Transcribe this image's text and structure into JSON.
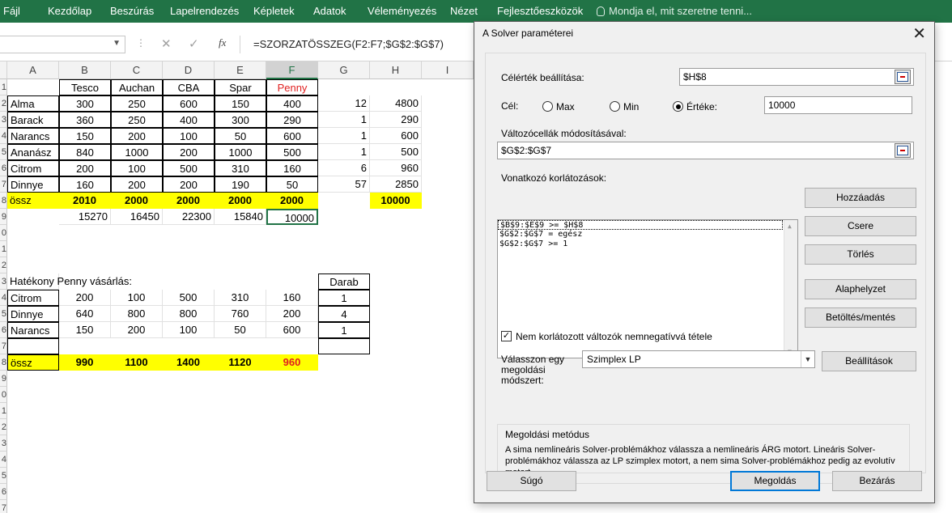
{
  "ribbon": {
    "tabs": [
      "Fájl",
      "Kezdőlap",
      "Beszúrás",
      "Lapelrendezés",
      "Képletek",
      "Adatok",
      "Véleményezés",
      "Nézet",
      "Fejlesztőeszközök"
    ],
    "tell_me": "Mondja el, mit szeretne tenni..."
  },
  "formula_bar": {
    "fx": "fx",
    "formula": "=SZORZATÖSSZEG(F2:F7;$G$2:$G$7)"
  },
  "sheet": {
    "columns": [
      "A",
      "B",
      "C",
      "D",
      "E",
      "F",
      "G",
      "H",
      "I"
    ],
    "row_numbers": [
      "1",
      "2",
      "3",
      "4",
      "5",
      "6",
      "7",
      "8",
      "9",
      "0",
      "1",
      "2",
      "3",
      "4",
      "5",
      "6",
      "7",
      "8",
      "9",
      "0",
      "1",
      "2",
      "3",
      "4",
      "5",
      "6",
      "7",
      "8"
    ],
    "header_row": [
      "",
      "Tesco",
      "Auchan",
      "CBA",
      "Spar",
      "Penny"
    ],
    "fruit_rows": [
      {
        "name": "Alma",
        "values": [
          "300",
          "250",
          "600",
          "150",
          "400"
        ],
        "g": "12",
        "h": "4800"
      },
      {
        "name": "Barack",
        "values": [
          "360",
          "250",
          "400",
          "300",
          "290"
        ],
        "g": "1",
        "h": "290"
      },
      {
        "name": "Narancs",
        "values": [
          "150",
          "200",
          "100",
          "50",
          "600"
        ],
        "g": "1",
        "h": "600"
      },
      {
        "name": "Ananász",
        "values": [
          "840",
          "1000",
          "200",
          "1000",
          "500"
        ],
        "g": "1",
        "h": "500"
      },
      {
        "name": "Citrom",
        "values": [
          "200",
          "100",
          "500",
          "310",
          "160"
        ],
        "g": "6",
        "h": "960"
      },
      {
        "name": "Dinnye",
        "values": [
          "160",
          "200",
          "200",
          "190",
          "50"
        ],
        "g": "57",
        "h": "2850"
      }
    ],
    "ossz_row": {
      "label": "össz",
      "values": [
        "2010",
        "2000",
        "2000",
        "2000",
        "2000"
      ],
      "h": "10000"
    },
    "product_row": [
      "15270",
      "16450",
      "22300",
      "15840",
      "10000"
    ],
    "hatekony_title": "Hatékony Penny vásárlás:",
    "darab_label": "Darab",
    "penny_rows": [
      {
        "name": "Citrom",
        "values": [
          "200",
          "100",
          "500",
          "310",
          "160"
        ],
        "darab": "1"
      },
      {
        "name": "Dinnye",
        "values": [
          "640",
          "800",
          "800",
          "760",
          "200"
        ],
        "darab": "4"
      },
      {
        "name": "Narancs",
        "values": [
          "150",
          "200",
          "100",
          "50",
          "600"
        ],
        "darab": "1"
      }
    ],
    "penny_ossz": {
      "label": "össz",
      "values": [
        "990",
        "1100",
        "1400",
        "1120",
        "960"
      ]
    }
  },
  "dialog": {
    "title": "A Solver paraméterei",
    "objective_label": "Célérték beállítása:",
    "objective_value": "$H$8",
    "to_label": "Cél:",
    "radio_max": "Max",
    "radio_min": "Min",
    "radio_value": "Értéke:",
    "target_value": "10000",
    "changing_label": "Változócellák módosításával:",
    "changing_value": "$G$2:$G$7",
    "constraints_label": "Vonatkozó korlátozások:",
    "constraints": [
      "$B$9:$E$9 >= $H$8",
      "$G$2:$G$7 = egész",
      "$G$2:$G$7 >= 1"
    ],
    "btn_add": "Hozzáadás",
    "btn_change": "Csere",
    "btn_delete": "Törlés",
    "btn_reset": "Alaphelyzet",
    "btn_loadsave": "Betöltés/mentés",
    "nonneg_label": "Nem korlátozott változók nemnegatívvá tétele",
    "method_label": "Válasszon egy megoldási módszert:",
    "method_value": "Szimplex LP",
    "btn_options": "Beállítások",
    "method_box_title": "Megoldási metódus",
    "method_box_text": "A sima nemlineáris Solver-problémákhoz válassza a nemlineáris ÁRG motort. Lineáris Solver-problémákhoz válassza az LP szimplex motort, a nem sima Solver-problémákhoz pedig az evolutív motort.",
    "btn_help": "Súgó",
    "btn_solve": "Megoldás",
    "btn_close": "Bezárás"
  }
}
